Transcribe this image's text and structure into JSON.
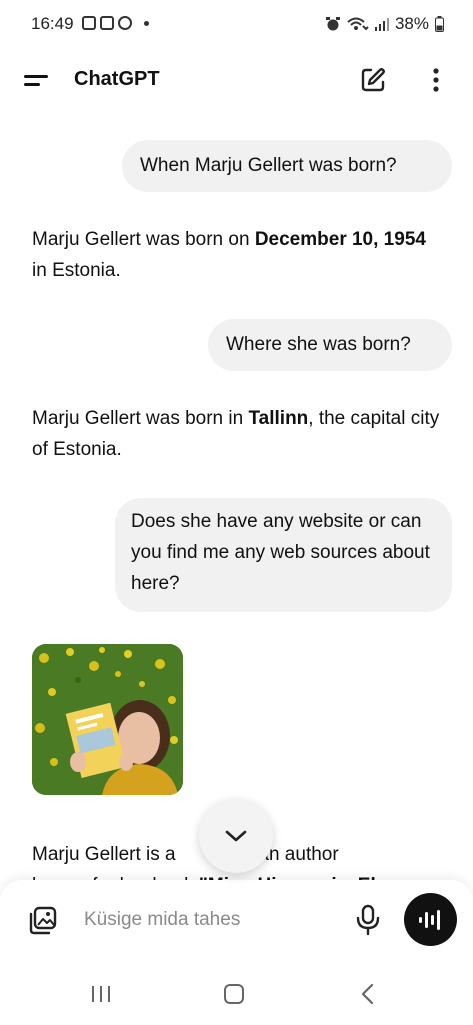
{
  "status_bar": {
    "time": "16:49",
    "battery": "38%"
  },
  "header": {
    "title": "ChatGPT"
  },
  "messages": [
    {
      "role": "user",
      "text": "When Marju Gellert was born?"
    },
    {
      "role": "assistant",
      "pre": "Marju Gellert was born on ",
      "bold": "December 10, 1954",
      "post": " in Estonia."
    },
    {
      "role": "user",
      "text": "Where she was born?"
    },
    {
      "role": "assistant",
      "pre": "Marju Gellert was born in ",
      "bold": "Tallinn",
      "post": ", the capital city of Estonia."
    },
    {
      "role": "user",
      "text": "Does she have any website or can you find me any web sources about here?"
    },
    {
      "role": "assistant_partial",
      "line1_pre": "Marju Gellert is a",
      "line1_post": "nian author",
      "line2_pre": "known for her book ",
      "line2_bold": "\"Minu Hispaania, Ely"
    }
  ],
  "input": {
    "placeholder": "Küsige mida tahes"
  },
  "icons": {
    "menu": "hamburger-menu-icon",
    "new_chat": "edit-pencil-icon",
    "more": "more-vertical-icon",
    "attach": "image-attach-icon",
    "mic": "microphone-icon",
    "voice": "voice-waveform-icon",
    "scroll": "chevron-down-icon"
  },
  "colors": {
    "bubble": "#f1f1f1",
    "voice_button": "#111111"
  }
}
